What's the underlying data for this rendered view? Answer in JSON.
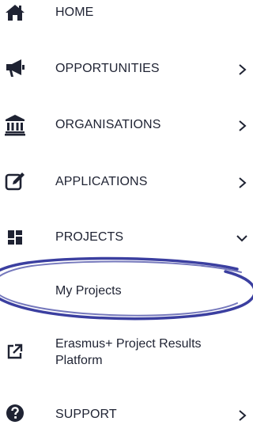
{
  "menu": {
    "home": {
      "label": "HOME",
      "icon": "home-icon"
    },
    "opportunities": {
      "label": "OPPORTUNITIES",
      "icon": "megaphone-icon"
    },
    "organisations": {
      "label": "ORGANISATIONS",
      "icon": "institution-icon"
    },
    "applications": {
      "label": "APPLICATIONS",
      "icon": "edit-icon"
    },
    "projects": {
      "label": "PROJECTS",
      "icon": "dashboard-icon",
      "expanded": true,
      "subitems": [
        {
          "label": "My Projects"
        }
      ]
    },
    "results_platform": {
      "label": "Erasmus+ Project Results Platform",
      "icon": "external-link-icon"
    },
    "support": {
      "label": "SUPPORT",
      "icon": "question-circle-icon"
    }
  },
  "annotation": {
    "color": "#3b3fa0"
  }
}
